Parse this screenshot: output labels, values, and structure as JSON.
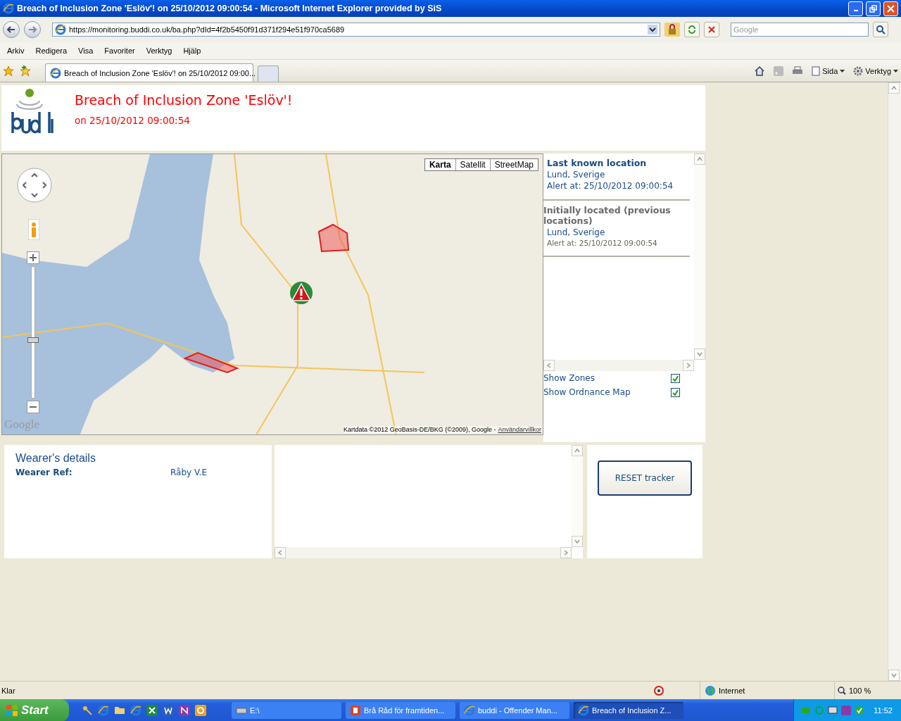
{
  "window": {
    "title": "Breach of Inclusion Zone 'Eslöv'! on 25/10/2012 09:00:54 - Microsoft Internet Explorer provided by SiS"
  },
  "address_bar": {
    "url": "https://monitoring.buddi.co.uk/ba.php?dId=4f2b5450f91d371f294e51f970ca5689",
    "search_placeholder": "Google"
  },
  "menu": [
    "Arkiv",
    "Redigera",
    "Visa",
    "Favoriter",
    "Verktyg",
    "Hjälp"
  ],
  "tabs": [
    {
      "label": "Breach of Inclusion Zone 'Eslöv'! on 25/10/2012 09:00...",
      "selected": true
    }
  ],
  "command_bar": [
    "Sida",
    "Verktyg"
  ],
  "header": {
    "title": "Breach of Inclusion Zone 'Eslöv'!",
    "subtitle": "on 25/10/2012 09:00:54"
  },
  "map": {
    "zoom": {
      "level": 0.44
    },
    "types": [
      {
        "label": "Karta",
        "selected": true
      },
      {
        "label": "Satellit",
        "selected": false
      },
      {
        "label": "StreetMap",
        "selected": false
      }
    ],
    "logo": "Google",
    "attribution": "Kartdata ©2012 GeoBasis-DE/BKG (©2009), Google -",
    "terms_link": "Användarvillkor"
  },
  "last_known": {
    "heading": "Last known location",
    "place": "Lund, Sverige",
    "alert": "Alert at: 25/10/2012 09:00:54"
  },
  "initially_located": {
    "heading": "Initially located (previous locations)",
    "place": "Lund, Sverige",
    "alert": "Alert at: 25/10/2012 09:00:54"
  },
  "toggles": [
    {
      "label": "Show Zones",
      "checked": true
    },
    {
      "label": "Show Ordnance Map",
      "checked": true
    }
  ],
  "wearer": {
    "heading": "Wearer's details",
    "fields": [
      {
        "label": "Wearer Ref:",
        "value": "Råby V.E"
      }
    ]
  },
  "reset_button": "RESET tracker",
  "status_bar": {
    "text": "Klar",
    "zone": "Internet",
    "zoom": "100 %"
  },
  "taskbar": {
    "start": "Start",
    "tasks": [
      {
        "label": "E:\\",
        "kind": "drive",
        "selected": false
      },
      {
        "label": "Brå Råd för framtiden...",
        "kind": "powerpoint",
        "selected": false
      },
      {
        "label": "buddi - Offender Man...",
        "kind": "browser",
        "selected": false
      },
      {
        "label": "Breach of Inclusion Z...",
        "kind": "browser",
        "selected": true
      }
    ],
    "clock": "11:52"
  }
}
